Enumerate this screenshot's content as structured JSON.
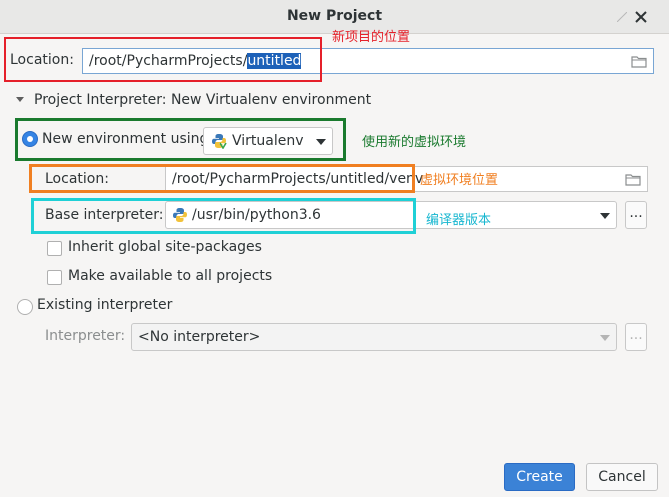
{
  "window": {
    "title": "New Project"
  },
  "location": {
    "label": "Location:",
    "value_prefix": "/root/PycharmProjects/",
    "value_selected": "untitled"
  },
  "interpreter_section": {
    "label": "Project Interpreter: New Virtualenv environment",
    "new_env": {
      "label": "New environment using",
      "tool_value": "Virtualenv",
      "location_label": "Location:",
      "location_value": "/root/PycharmProjects/untitled/venv",
      "base_label": "Base interpreter:",
      "base_value": "/usr/bin/python3.6",
      "browse_label": "...",
      "inherit_label": "Inherit global site-packages",
      "available_label": "Make available to all projects"
    },
    "existing": {
      "label": "Existing interpreter",
      "interpreter_label": "Interpreter:",
      "interpreter_value": "<No interpreter>",
      "browse_label": "..."
    }
  },
  "buttons": {
    "create": "Create",
    "cancel": "Cancel"
  },
  "annotations": {
    "location_note": "新项目的位置",
    "new_env_note": "使用新的虚拟环境",
    "venv_location_note": "虚拟环境位置",
    "base_interpreter_note": "编译器版本"
  },
  "colors": {
    "red": "#e5202a",
    "green": "#1a7a2e",
    "orange": "#f07f21",
    "cyan": "#1fd0d6",
    "cyan_text": "#18b7d0",
    "accent": "#3584e4"
  }
}
